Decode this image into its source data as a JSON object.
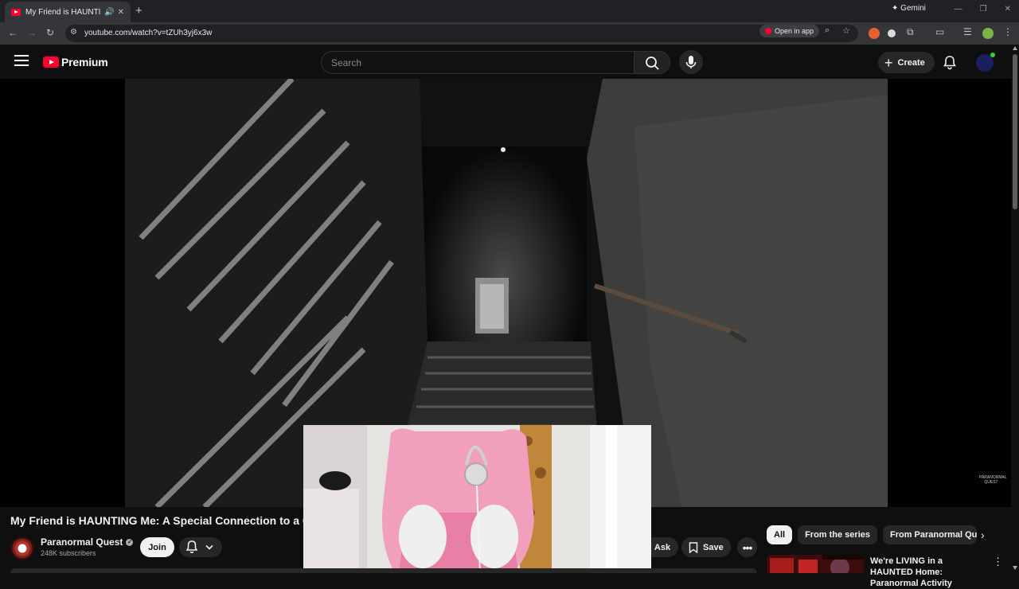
{
  "browser": {
    "tab_title": "My Friend is HAUNTING Me",
    "url": "youtube.com/watch?v=tZUh3yj6x3w",
    "open_in_app": "Open in app",
    "gemini": "Gemini"
  },
  "masthead": {
    "logo": "Premium",
    "search_placeholder": "Search",
    "create": "Create"
  },
  "video": {
    "title": "My Friend is HAUNTING Me: A Special Connection to a G",
    "watermark": "PARANORMAL QUEST"
  },
  "channel": {
    "name": "Paranormal Quest",
    "subscribers": "248K subscribers",
    "join": "Join"
  },
  "actions": {
    "ask": "Ask",
    "save": "Save"
  },
  "chips": [
    "All",
    "From the series",
    "From Paranormal Quest"
  ],
  "recommendation": {
    "title": "We're LIVING in a HAUNTED Home: Paranormal Activity"
  },
  "colors": {
    "youtube_red": "#ff0033",
    "background": "#0f0f0f",
    "chip_bg": "#272727"
  }
}
